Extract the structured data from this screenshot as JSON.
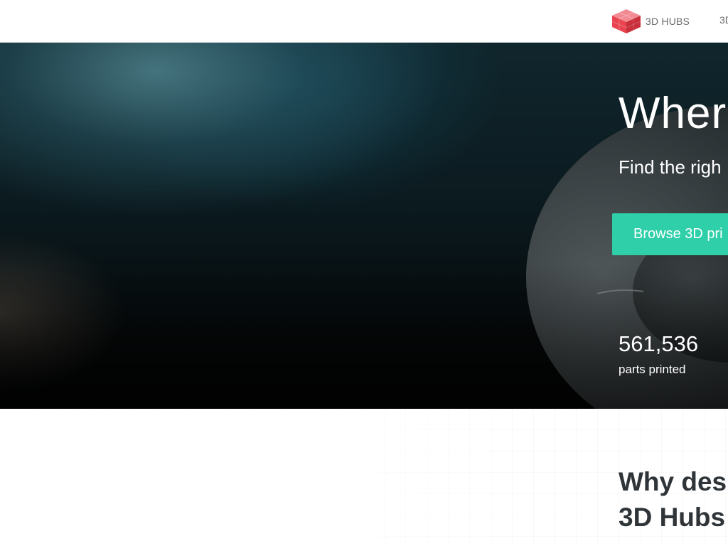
{
  "header": {
    "logo_text": "3D HUBS",
    "logo_icon": "hub-cube-icon",
    "nav": [
      {
        "label": "3D"
      }
    ]
  },
  "hero": {
    "title": "Wher",
    "subtitle": "Find the righ",
    "cta_label": "Browse 3D pri",
    "stat_value": "561,536",
    "stat_label": "parts printed"
  },
  "why_section": {
    "heading_line1": "Why des",
    "heading_line2": "3D Hubs"
  },
  "colors": {
    "accent": "#2ecfa9",
    "logo_red": "#e8434f",
    "heading": "#2f3438",
    "nav_text": "#6b6b6b"
  }
}
